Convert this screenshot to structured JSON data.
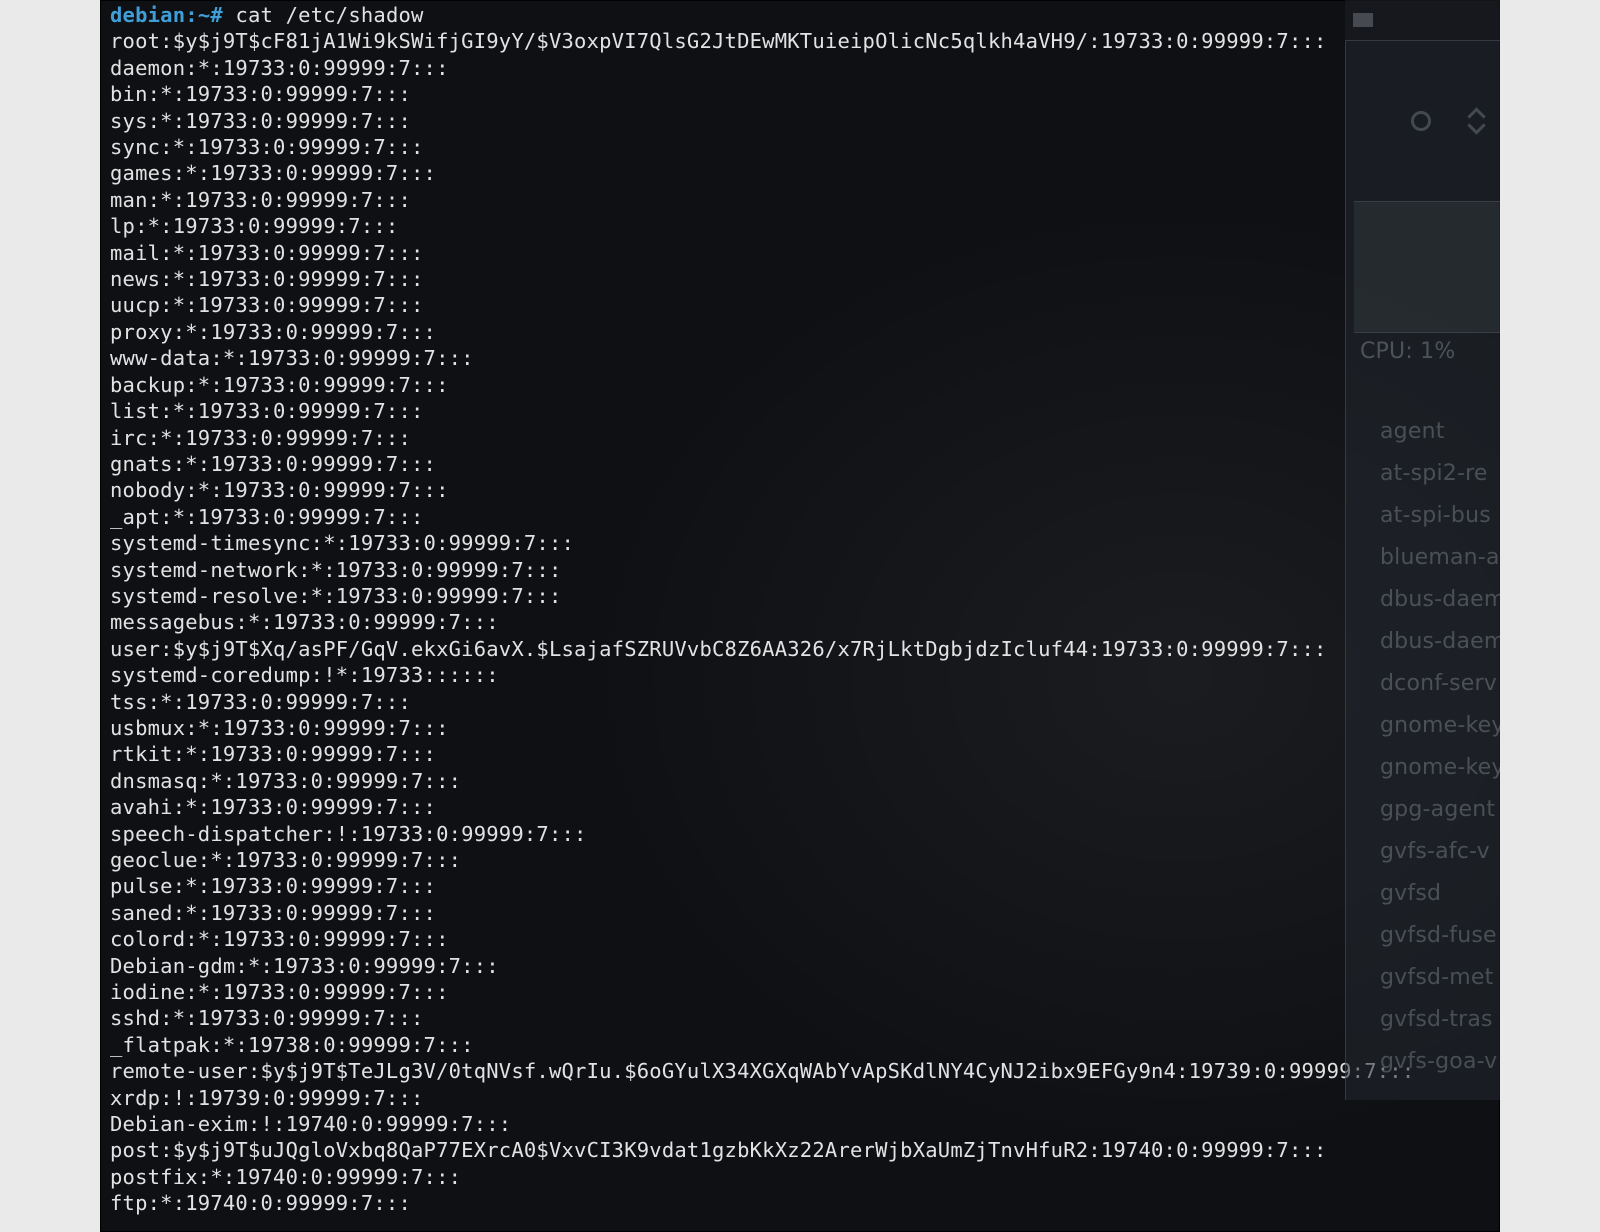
{
  "prompt": {
    "host": "debian",
    "sep": ":",
    "path": "~",
    "symbol": "#"
  },
  "command": "cat /etc/shadow",
  "lines": [
    "root:$y$j9T$cF81jA1Wi9kSWifjGI9yY/$V3oxpVI7QlsG2JtDEwMKTuieipOlicNc5qlkh4aVH9/:19733:0:99999:7:::",
    "daemon:*:19733:0:99999:7:::",
    "bin:*:19733:0:99999:7:::",
    "sys:*:19733:0:99999:7:::",
    "sync:*:19733:0:99999:7:::",
    "games:*:19733:0:99999:7:::",
    "man:*:19733:0:99999:7:::",
    "lp:*:19733:0:99999:7:::",
    "mail:*:19733:0:99999:7:::",
    "news:*:19733:0:99999:7:::",
    "uucp:*:19733:0:99999:7:::",
    "proxy:*:19733:0:99999:7:::",
    "www-data:*:19733:0:99999:7:::",
    "backup:*:19733:0:99999:7:::",
    "list:*:19733:0:99999:7:::",
    "irc:*:19733:0:99999:7:::",
    "gnats:*:19733:0:99999:7:::",
    "nobody:*:19733:0:99999:7:::",
    "_apt:*:19733:0:99999:7:::",
    "systemd-timesync:*:19733:0:99999:7:::",
    "systemd-network:*:19733:0:99999:7:::",
    "systemd-resolve:*:19733:0:99999:7:::",
    "messagebus:*:19733:0:99999:7:::",
    "user:$y$j9T$Xq/asPF/GqV.ekxGi6avX.$LsajafSZRUVvbC8Z6AA326/x7RjLktDgbjdzIcluf44:19733:0:99999:7:::",
    "systemd-coredump:!*:19733::::::",
    "tss:*:19733:0:99999:7:::",
    "usbmux:*:19733:0:99999:7:::",
    "rtkit:*:19733:0:99999:7:::",
    "dnsmasq:*:19733:0:99999:7:::",
    "avahi:*:19733:0:99999:7:::",
    "speech-dispatcher:!:19733:0:99999:7:::",
    "geoclue:*:19733:0:99999:7:::",
    "pulse:*:19733:0:99999:7:::",
    "saned:*:19733:0:99999:7:::",
    "colord:*:19733:0:99999:7:::",
    "Debian-gdm:*:19733:0:99999:7:::",
    "iodine:*:19733:0:99999:7:::",
    "sshd:*:19733:0:99999:7:::",
    "_flatpak:*:19738:0:99999:7:::",
    "remote-user:$y$j9T$TeJLg3V/0tqNVsf.wQrIu.$6oGYulX34XGXqWAbYvApSKdlNY4CyNJ2ibx9EFGy9n4:19739:0:99999:7:::",
    "xrdp:!:19739:0:99999:7:::",
    "Debian-exim:!:19740:0:99999:7:::",
    "post:$y$j9T$uJQgloVxbq8QaP77EXrcA0$VxvCI3K9vdat1gzbKkXz22ArerWjbXaUmZjTnvHfuR2:19740:0:99999:7:::",
    "postfix:*:19740:0:99999:7:::",
    "ftp:*:19740:0:99999:7:::"
  ],
  "side_panel": {
    "cpu_label": "CPU: 1%",
    "processes": [
      "agent",
      "at-spi2-re",
      "at-spi-bus",
      "blueman-a",
      "dbus-daem",
      "dbus-daem",
      "dconf-serv",
      "gnome-key",
      "gnome-key",
      "gpg-agent",
      "gvfs-afc-v",
      "gvfsd",
      "gvfsd-fuse",
      "gvfsd-met",
      "gvfsd-tras",
      "gvfs-goa-v"
    ]
  }
}
